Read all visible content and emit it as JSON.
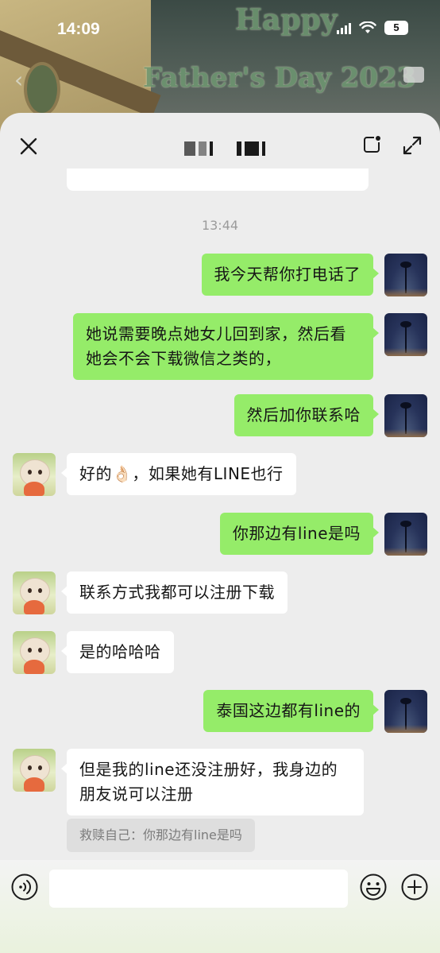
{
  "status_bar": {
    "time": "14:09",
    "battery": "5"
  },
  "wallpaper": {
    "line1": "Happy",
    "line2": "Father's Day 2023"
  },
  "header": {
    "title": "",
    "close_icon": "close-icon",
    "float_icon": "floating-window-icon",
    "expand_icon": "expand-icon"
  },
  "chat": {
    "timestamp": "13:44",
    "messages": [
      {
        "from": "me",
        "text": "我今天帮你打电话了"
      },
      {
        "from": "me",
        "text": "她说需要晚点她女儿回到家，然后看她会不会下载微信之类的，"
      },
      {
        "from": "me",
        "text": "然后加你联系哈"
      },
      {
        "from": "them",
        "text": "好的👌🏻，如果她有LINE也行"
      },
      {
        "from": "me",
        "text": "你那边有line是吗"
      },
      {
        "from": "them",
        "text": "联系方式我都可以注册下载"
      },
      {
        "from": "them",
        "text": "是的哈哈哈"
      },
      {
        "from": "me",
        "text": "泰国这边都有line的"
      },
      {
        "from": "them",
        "text": "但是我的line还没注册好，我身边的朋友说可以注册"
      }
    ],
    "quote": "救赎自己：你那边有line是吗"
  },
  "input_bar": {
    "placeholder": "",
    "voice_icon": "voice-icon",
    "emoji_icon": "emoji-icon",
    "plus_icon": "plus-icon"
  },
  "colors": {
    "my_bubble": "#95ec69",
    "their_bubble": "#ffffff",
    "chat_bg": "#ededed"
  }
}
